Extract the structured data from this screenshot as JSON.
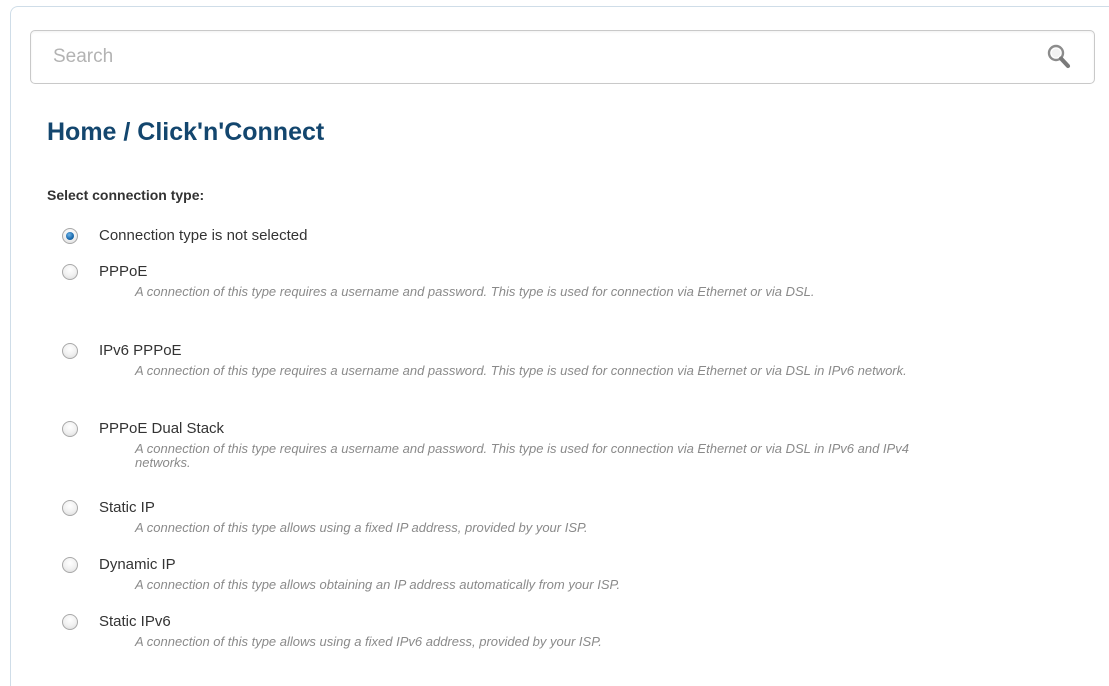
{
  "search": {
    "placeholder": "Search"
  },
  "breadcrumb": "Home /  Click'n'Connect",
  "section_label": "Select connection type:",
  "options": [
    {
      "label": "Connection type is not selected",
      "description": "",
      "checked": true
    },
    {
      "label": "PPPoE",
      "description": "A connection of this type requires a username and password. This type is used for connection via Ethernet or via DSL.",
      "checked": false
    },
    {
      "label": "IPv6 PPPoE",
      "description": "A connection of this type requires a username and password. This type is used for connection via Ethernet or via DSL in IPv6 network.",
      "checked": false
    },
    {
      "label": "PPPoE Dual Stack",
      "description": "A connection of this type requires a username and password. This type is used for connection via Ethernet or via DSL in IPv6 and IPv4 networks.",
      "checked": false
    },
    {
      "label": "Static IP",
      "description": "A connection of this type allows using a fixed IP address, provided by your ISP.",
      "checked": false
    },
    {
      "label": "Dynamic IP",
      "description": "A connection of this type allows obtaining an IP address automatically from your ISP.",
      "checked": false
    },
    {
      "label": "Static IPv6",
      "description": "A connection of this type allows using a fixed IPv6 address, provided by your ISP.",
      "checked": false
    }
  ],
  "colors": {
    "heading": "#13466e",
    "radio_accent": "#1d6db0",
    "description_text": "#8a8a8a"
  }
}
